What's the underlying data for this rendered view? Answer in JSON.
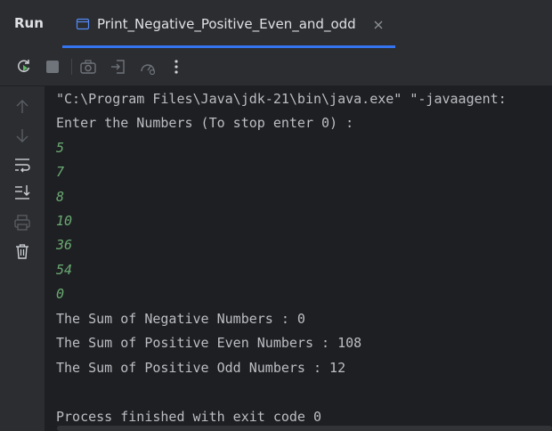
{
  "tool_window": {
    "title": "Run"
  },
  "tab": {
    "label": "Print_Negative_Positive_Even_and_odd",
    "icon": "application-icon",
    "close_icon": "close-icon"
  },
  "toolbar": {
    "buttons": [
      "rerun-icon",
      "stop-icon",
      "screenshot-icon",
      "restore-layout-icon",
      "profiler-icon",
      "more-options-icon"
    ]
  },
  "gutter": {
    "buttons": [
      "up-arrow-icon",
      "down-arrow-icon",
      "soft-wrap-icon",
      "scroll-to-end-icon",
      "print-icon",
      "trash-icon"
    ]
  },
  "console": {
    "command": "\"C:\\Program Files\\Java\\jdk-21\\bin\\java.exe\" \"-javaagent:",
    "prompt": "Enter the Numbers (To stop enter 0) :",
    "inputs": [
      "5",
      "7",
      "8",
      "10",
      "36",
      "54",
      "0"
    ],
    "negative_sum": "The Sum of Negative Numbers : 0",
    "positive_even_sum": "The Sum of Positive Even Numbers : 108",
    "positive_odd_sum": "The Sum of Positive Odd Numbers : 12",
    "exit_message": "Process finished with exit code 0"
  },
  "colors": {
    "panel_bg": "#2b2d30",
    "console_bg": "#1e1f22",
    "text": "#bcbec4",
    "input_text": "#6aab73",
    "accent": "#3574f0"
  }
}
